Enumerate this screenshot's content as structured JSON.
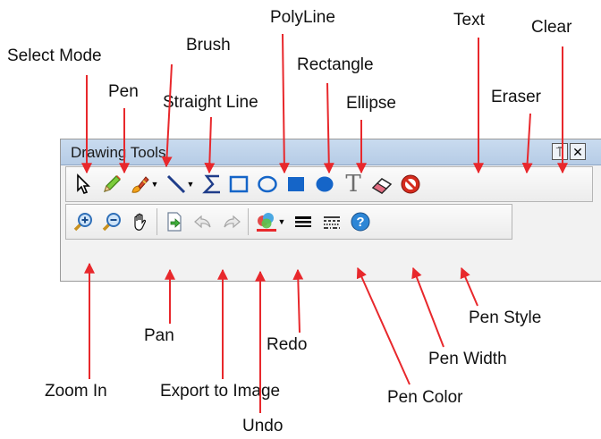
{
  "window": {
    "title": "Drawing Tools",
    "pin_glyph": "⍑",
    "close_glyph": "✕"
  },
  "callouts": {
    "select_mode": "Select Mode",
    "pen": "Pen",
    "brush": "Brush",
    "straight_line": "Straight Line",
    "polyline": "PolyLine",
    "rectangle": "Rectangle",
    "ellipse": "Ellipse",
    "text": "Text",
    "eraser": "Eraser",
    "clear": "Clear",
    "zoom_in": "Zoom In",
    "pan": "Pan",
    "export_to_image": "Export to Image",
    "undo": "Undo",
    "redo": "Redo",
    "pen_color": "Pen Color",
    "pen_width": "Pen Width",
    "pen_style": "Pen Style"
  },
  "toolbar_row1": {
    "tools": [
      "select-mode",
      "pen",
      "brush",
      "straight-line",
      "polyline",
      "rectangle",
      "ellipse",
      "filled-rectangle",
      "filled-ellipse",
      "text",
      "eraser",
      "clear"
    ],
    "text_glyph": "T"
  },
  "toolbar_row2": {
    "tools": [
      "zoom-in",
      "zoom-out",
      "pan",
      "export-to-image",
      "undo",
      "redo",
      "pen-color",
      "pen-width",
      "pen-style",
      "help"
    ],
    "help_glyph": "?"
  },
  "colors": {
    "arrow": "#e8282c",
    "titlebar": "#c9dbef",
    "shape_blue": "#1565c8",
    "clear_red": "#d52b1e"
  }
}
